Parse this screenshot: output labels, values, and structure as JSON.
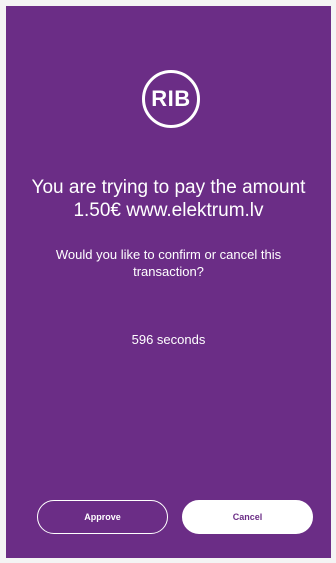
{
  "logo": {
    "text": "RIB"
  },
  "prompt": {
    "line1": "You are trying to pay the amount",
    "line2": "1.50€ www.elektrum.lv",
    "question": "Would you like to confirm or cancel this transaction?"
  },
  "timer": {
    "text": "596 seconds"
  },
  "buttons": {
    "approve": "Approve",
    "cancel": "Cancel"
  },
  "colors": {
    "background": "#6b2d86",
    "foreground": "#ffffff"
  }
}
